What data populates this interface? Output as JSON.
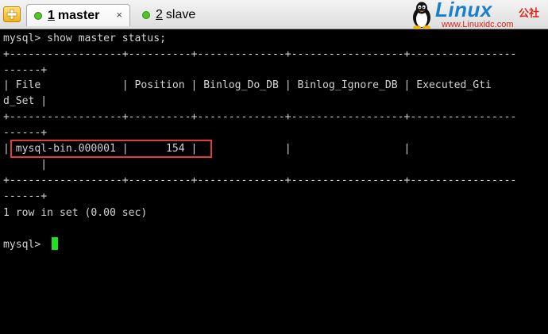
{
  "tabs": [
    {
      "number": "1",
      "label": "master",
      "active": true
    },
    {
      "number": "2",
      "label": "slave",
      "active": false
    }
  ],
  "tab_close": "×",
  "logo": {
    "brand": "Linux",
    "suffix": "公社",
    "url": "www.Linuxidc.com"
  },
  "terminal": {
    "lines": [
      "mysql> show master status;",
      "+------------------+----------+--------------+------------------+-----------------",
      "------+",
      "| File             | Position | Binlog_Do_DB | Binlog_Ignore_DB | Executed_Gti",
      "d_Set |",
      "+------------------+----------+--------------+------------------+-----------------",
      "------+",
      "| mysql-bin.000001 |      154 |              |                  |",
      "      |",
      "+------------------+----------+--------------+------------------+-----------------",
      "------+",
      "1 row in set (0.00 sec)",
      "",
      "mysql> "
    ]
  },
  "colors": {
    "terminal_bg": "#000000",
    "terminal_fg": "#d2d2d2",
    "cursor": "#1de21d",
    "highlight": "#e23b3b",
    "brand_blue": "#1680cf",
    "brand_red": "#d9251c"
  },
  "icons": {
    "add_tab": "plus-icon",
    "tab_status": "green-dot-icon",
    "logo": "penguin-icon"
  }
}
